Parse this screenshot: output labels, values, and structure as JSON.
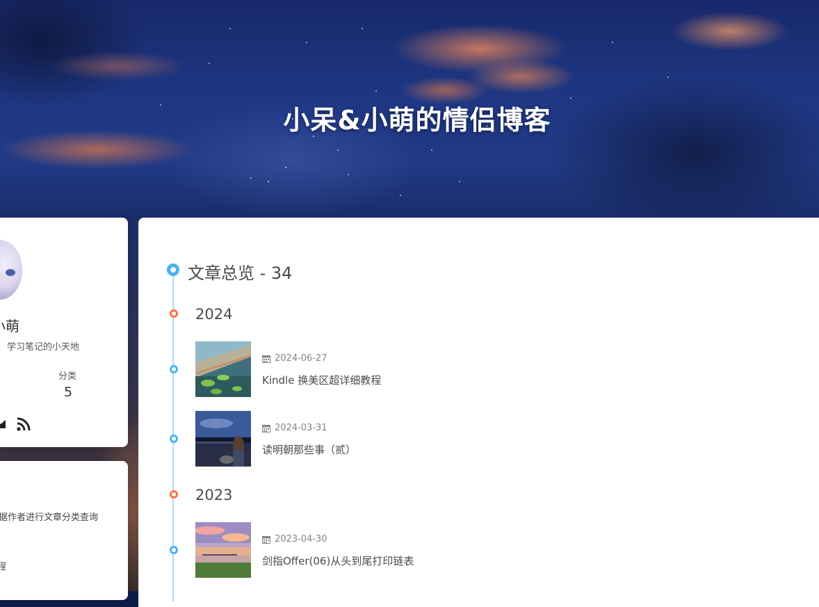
{
  "site": {
    "title": "小呆&小萌的情侣博客"
  },
  "author": {
    "name_fragment": "小萌",
    "description": "学习笔记的小天地",
    "stats": [
      {
        "label": "分类",
        "value": "5"
      }
    ]
  },
  "category_card": {
    "text_lines": [
      "据作者进行文章分类查询",
      "程"
    ]
  },
  "archive": {
    "heading": "文章总览 - 34",
    "years": [
      {
        "year": "2024",
        "posts": [
          {
            "date": "2024-06-27",
            "title": "Kindle 换美区超详细教程"
          },
          {
            "date": "2024-03-31",
            "title": "读明朝那些事（贰）"
          }
        ]
      },
      {
        "year": "2023",
        "posts": [
          {
            "date": "2023-04-30",
            "title": "剑指Offer(06)从头到尾打印链表"
          }
        ]
      }
    ]
  },
  "colors": {
    "accent_blue": "#49b1f5",
    "accent_orange": "#ff7242",
    "text": "#4c4948"
  }
}
